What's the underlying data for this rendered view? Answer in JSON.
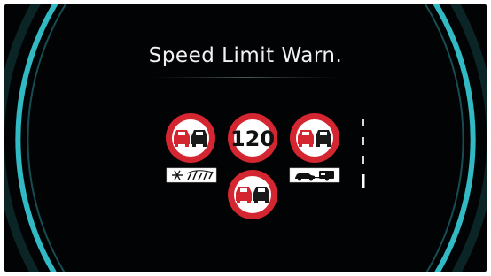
{
  "screen": {
    "title": "Speed Limit Warn."
  },
  "signs": [
    {
      "type": "no-overtaking",
      "name": "no-overtaking-sign-left"
    },
    {
      "type": "speed-limit",
      "value": "120",
      "name": "speed-limit-sign"
    },
    {
      "type": "no-overtaking",
      "name": "no-overtaking-sign-right"
    },
    {
      "type": "no-overtaking",
      "name": "no-overtaking-sign-bottom"
    }
  ],
  "supplementary_plates": [
    {
      "icon": "snow-rain-icon",
      "name": "weather-plate"
    },
    {
      "icon": "car-trailer-icon",
      "name": "trailer-plate"
    }
  ],
  "colors": {
    "accent_arc": "#35c4cf",
    "sign_border": "#d32630",
    "sign_fill": "#ffffff",
    "car_red": "#d32630",
    "car_dark": "#1a1a1a",
    "background": "#020304",
    "title_text": "#f2f2f2"
  }
}
